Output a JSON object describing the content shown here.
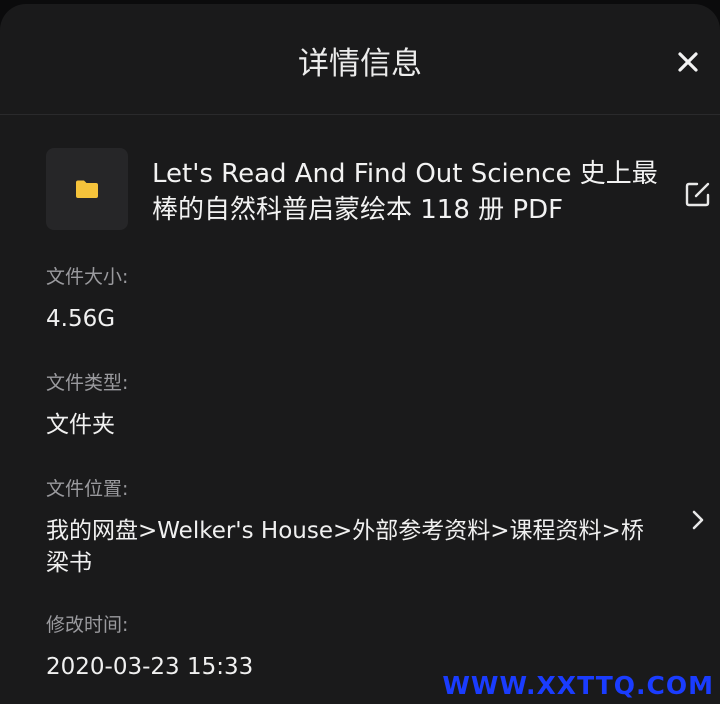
{
  "sheet": {
    "title": "详情信息"
  },
  "file": {
    "name": "Let's Read And Find Out Science 史上最棒的自然科普启蒙绘本 118 册 PDF"
  },
  "fields": {
    "size_label": "文件大小:",
    "size_value": "4.56G",
    "type_label": "文件类型:",
    "type_value": "文件夹",
    "location_label": "文件位置:",
    "location_value": "我的网盘>Welker's House>外部参考资料>课程资料>桥梁书",
    "modified_label": "修改时间:",
    "modified_value": "2020-03-23 15:33"
  },
  "watermark": "WWW.XXTTQ.COM",
  "colors": {
    "background": "#1a1a1b",
    "folder": "#f5c33b",
    "label": "#9a9a9e",
    "watermark": "#1a3cff"
  },
  "icons": {
    "close": "close-icon",
    "folder": "folder-icon",
    "edit": "edit-icon",
    "chevron": "chevron-right-icon"
  }
}
